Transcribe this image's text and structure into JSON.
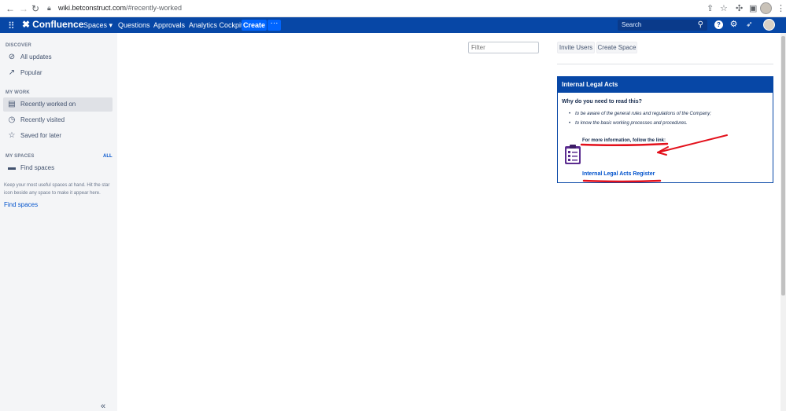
{
  "browser": {
    "url_host": "wiki.betconstruct.com",
    "url_path": "/#recently-worked"
  },
  "topnav": {
    "logo": "Confluence",
    "items": [
      "Spaces ▾",
      "Questions",
      "Approvals",
      "Analytics Cockpit"
    ],
    "create": "Create",
    "more": "···",
    "search_placeholder": "Search"
  },
  "sidebar": {
    "discover_label": "DISCOVER",
    "discover_items": [
      "All updates",
      "Popular"
    ],
    "mywork_label": "MY WORK",
    "mywork_items": [
      "Recently worked on",
      "Recently visited",
      "Saved for later"
    ],
    "myspaces_label": "MY SPACES",
    "all_link": "ALL",
    "find_spaces_item": "Find spaces",
    "hint": "Keep your most useful spaces at hand. Hit the star icon beside any space to make it appear here.",
    "find_spaces_link": "Find spaces"
  },
  "main": {
    "filter_placeholder": "Filter",
    "invite_users": "Invite Users",
    "create_space": "Create Space"
  },
  "panel": {
    "title": "Internal Legal Acts",
    "question": "Why do you need to read this?",
    "bullets": [
      "to be aware of the general rules and regulations of the Company;",
      "to know the basic working processes and procedures."
    ],
    "more_info": "For more information, follow the link:",
    "link": "Internal Legal Acts Register"
  },
  "colors": {
    "topnav": "#0747a6",
    "create_button": "#0065ff",
    "annotation": "#e3101b",
    "clipboard": "#5b2c8f"
  }
}
